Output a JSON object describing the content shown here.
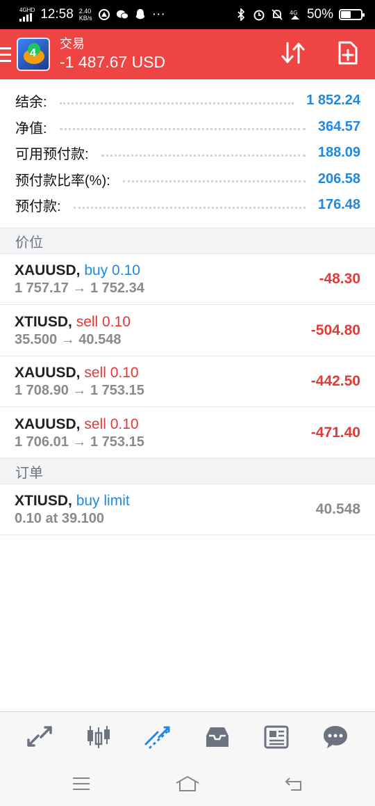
{
  "status_bar": {
    "network": "4GHD",
    "time": "12:58",
    "speed_value": "2.40",
    "speed_unit": "KB/s",
    "battery": "50%",
    "icons": [
      "bluetooth-icon",
      "alarm-icon",
      "mute-icon",
      "4g-icon",
      "battery-icon"
    ]
  },
  "header": {
    "title": "交易",
    "balance": "-1 487.67 USD"
  },
  "summary": [
    {
      "label": "结余:",
      "value": "1 852.24"
    },
    {
      "label": "净值:",
      "value": "364.57"
    },
    {
      "label": "可用预付款:",
      "value": "188.09"
    },
    {
      "label": "预付款比率(%):",
      "value": "206.58"
    },
    {
      "label": "预付款:",
      "value": "176.48"
    }
  ],
  "sections": {
    "positions": "价位",
    "orders": "订单"
  },
  "positions": [
    {
      "symbol": "XAUUSD,",
      "side": "buy 0.10",
      "prices": "1 757.17 → 1 752.34",
      "pl": "-48.30"
    },
    {
      "symbol": "XTIUSD,",
      "side": "sell 0.10",
      "prices": "35.500 → 40.548",
      "pl": "-504.80"
    },
    {
      "symbol": "XAUUSD,",
      "side": "sell 0.10",
      "prices": "1 708.90 → 1 753.15",
      "pl": "-442.50"
    },
    {
      "symbol": "XAUUSD,",
      "side": "sell 0.10",
      "prices": "1 706.01 → 1 753.15",
      "pl": "-471.40"
    }
  ],
  "orders": [
    {
      "symbol": "XTIUSD,",
      "side": "buy limit",
      "detail": "0.10 at 39.100",
      "price": "40.548"
    }
  ],
  "colors": {
    "header": "#ef4444",
    "value_blue": "#1e88e5",
    "loss_red": "#e53935",
    "muted": "#8a8a8a"
  },
  "bottom_nav": [
    "quotes-icon",
    "chart-icon",
    "trade-icon",
    "history-icon",
    "news-icon",
    "chat-icon"
  ]
}
